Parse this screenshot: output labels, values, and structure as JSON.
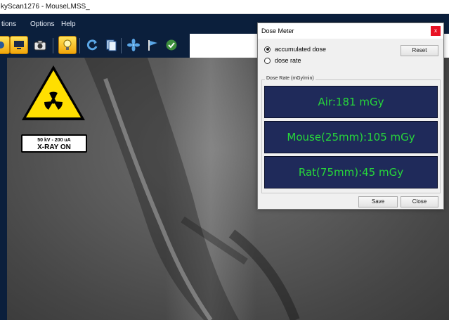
{
  "window": {
    "title": "kyScan1276 - MouseLMSS_"
  },
  "menu": {
    "items": [
      "tions",
      "Options",
      "Help"
    ]
  },
  "toolbar": {
    "buttons": [
      {
        "name": "scan-icon",
        "active": true
      },
      {
        "name": "monitor-icon",
        "active": true
      },
      {
        "name": "camera-icon",
        "active": false
      },
      {
        "name": "lightbulb-icon",
        "active": true
      },
      {
        "name": "refresh-icon",
        "active": false
      },
      {
        "name": "documents-icon",
        "active": false
      },
      {
        "name": "fan-icon",
        "active": false
      },
      {
        "name": "flag-icon",
        "active": false
      },
      {
        "name": "check-icon",
        "active": false
      }
    ]
  },
  "overlay": {
    "xray_line1": "50 kV - 200 uA",
    "xray_line2": "X-RAY ON"
  },
  "dose_meter": {
    "title": "Dose Meter",
    "close_glyph": "x",
    "radio_accumulated": "accumulated dose",
    "radio_rate": "dose rate",
    "selected": "accumulated dose",
    "reset_label": "Reset",
    "group_label": "Dose Rate (mGy/min)",
    "readouts": {
      "air": "Air:181 mGy",
      "mouse": "Mouse(25mm):105 mGy",
      "rat": "Rat(75mm):45 mGy"
    },
    "save_label": "Save",
    "close_label": "Close"
  },
  "colors": {
    "menubar": "#0b1f3c",
    "toolbar_active": "#f2a60a",
    "panel_bg": "#1f2a5a",
    "panel_text": "#27d83a",
    "warning_yellow": "#ffdf00"
  }
}
